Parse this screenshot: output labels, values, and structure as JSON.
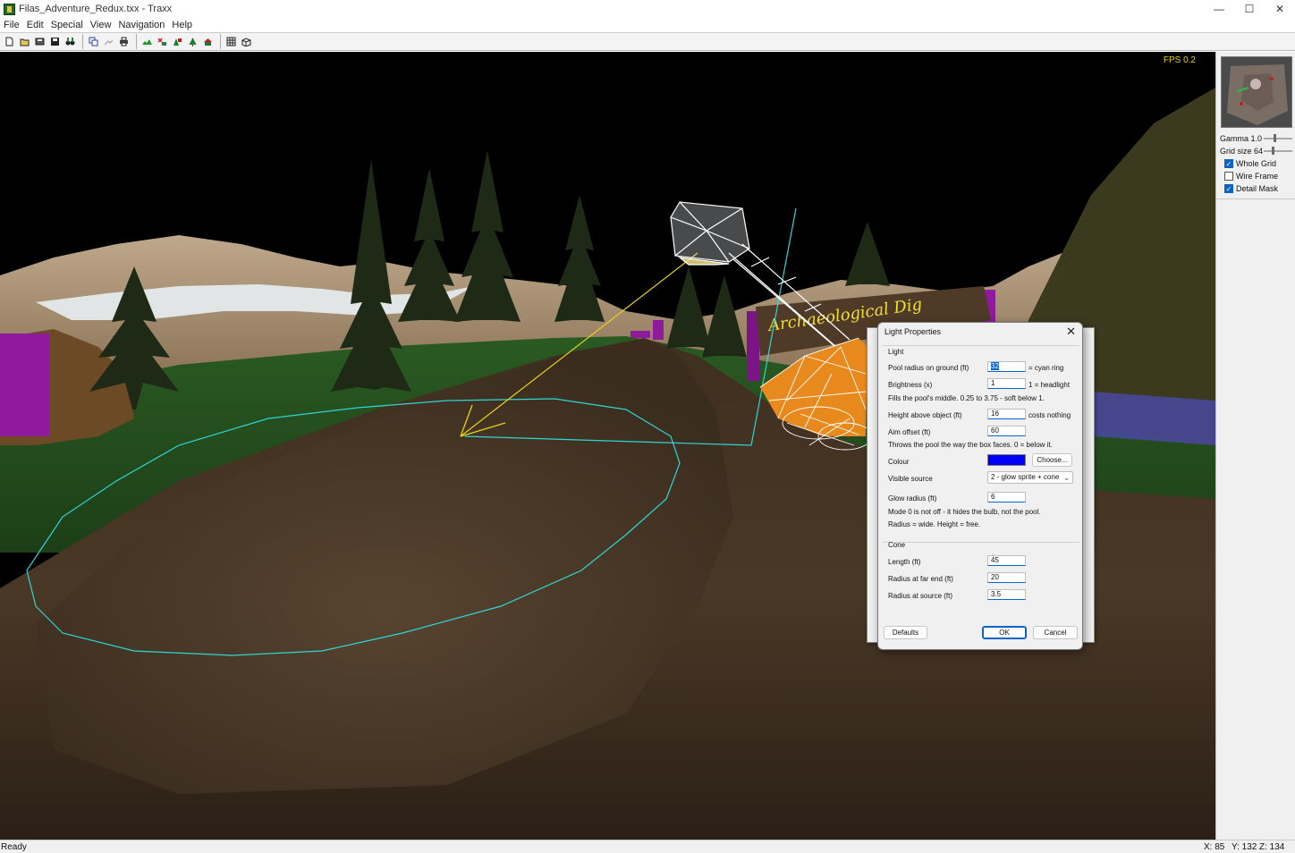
{
  "window": {
    "title": "Filas_Adventure_Redux.txx - Traxx",
    "controls": {
      "minimize": "—",
      "maximize": "☐",
      "close": "✕"
    }
  },
  "menu": [
    "File",
    "Edit",
    "Special",
    "View",
    "Navigation",
    "Help"
  ],
  "toolbar": {
    "groups": [
      [
        "new-file-icon",
        "open-folder-icon",
        "save-as-icon",
        "save-icon",
        "binoculars-icon"
      ],
      [
        "copy-icon",
        "paste-icon",
        "print-icon"
      ],
      [
        "terrain-icon",
        "object-place-icon",
        "tree-grid-icon",
        "tree-icon",
        "house-icon"
      ],
      [
        "grid-icon",
        "view-3d-icon"
      ]
    ]
  },
  "viewport": {
    "fps_text": "FPS 0.2"
  },
  "right_panel": {
    "gamma_label": "Gamma 1.0",
    "grid_size_label": "Grid size 64",
    "gamma_level": 0.3,
    "grid_level": 0.25,
    "checkboxes": [
      {
        "label": "Whole Grid",
        "checked": true
      },
      {
        "label": "Wire Frame",
        "checked": false
      },
      {
        "label": "Detail Mask",
        "checked": true
      }
    ]
  },
  "status": {
    "text": "Ready",
    "x": "X: 85",
    "y": "Y: 132",
    "z": "Z: 134"
  },
  "dialog": {
    "title": "Light Properties",
    "light_group": "Light",
    "pool_radius_label": "Pool radius on ground (ft)",
    "pool_radius_value": "32",
    "pool_radius_note": "= cyan ring",
    "brightness_label": "Brightness (x)",
    "brightness_value": "1",
    "brightness_note": "1 = headlight",
    "brightness_help": "Fills the pool's middle.  0.25 to 3.75 - soft below 1.",
    "height_label": "Height above object (ft)",
    "height_value": "16",
    "height_note": "costs nothing",
    "aim_label": "Aim offset (ft)",
    "aim_value": "60",
    "aim_help": "Throws the pool the way the box faces.  0 = below it.",
    "colour_label": "Colour",
    "colour_value": "#0000f5",
    "choose_label": "Choose...",
    "visible_source_label": "Visible source",
    "visible_source_value": "2 - glow sprite + cone",
    "glow_radius_label": "Glow radius (ft)",
    "glow_radius_value": "6",
    "mode_help": "Mode 0 is not off - it hides the bulb, not the pool.",
    "radius_help": "Radius = wide.  Height = free.",
    "cone_group": "Cone",
    "length_label": "Length (ft)",
    "length_value": "45",
    "far_radius_label": "Radius at far end (ft)",
    "far_radius_value": "20",
    "source_radius_label": "Radius at source (ft)",
    "source_radius_value": "3.5",
    "defaults_label": "Defaults",
    "ok_label": "OK",
    "cancel_label": "Cancel"
  }
}
